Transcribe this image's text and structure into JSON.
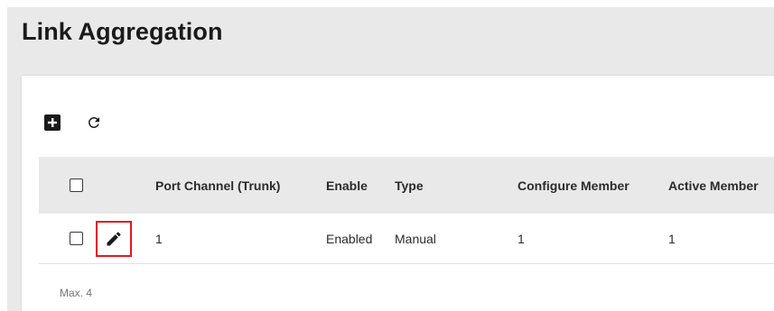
{
  "page": {
    "title": "Link Aggregation"
  },
  "toolbar": {
    "add_icon": "add-box-icon",
    "refresh_icon": "refresh-icon"
  },
  "table": {
    "columns": [
      "Port Channel (Trunk)",
      "Enable",
      "Type",
      "Configure Member",
      "Active Member"
    ],
    "rows": [
      {
        "port_channel": "1",
        "enable": "Enabled",
        "type": "Manual",
        "configure_member": "1",
        "active_member": "1"
      }
    ]
  },
  "footer": {
    "note": "Max. 4"
  },
  "colors": {
    "accent_highlight": "#e21a1a",
    "header_bg": "#e9e9e9",
    "page_bg": "#e9e9e9"
  }
}
